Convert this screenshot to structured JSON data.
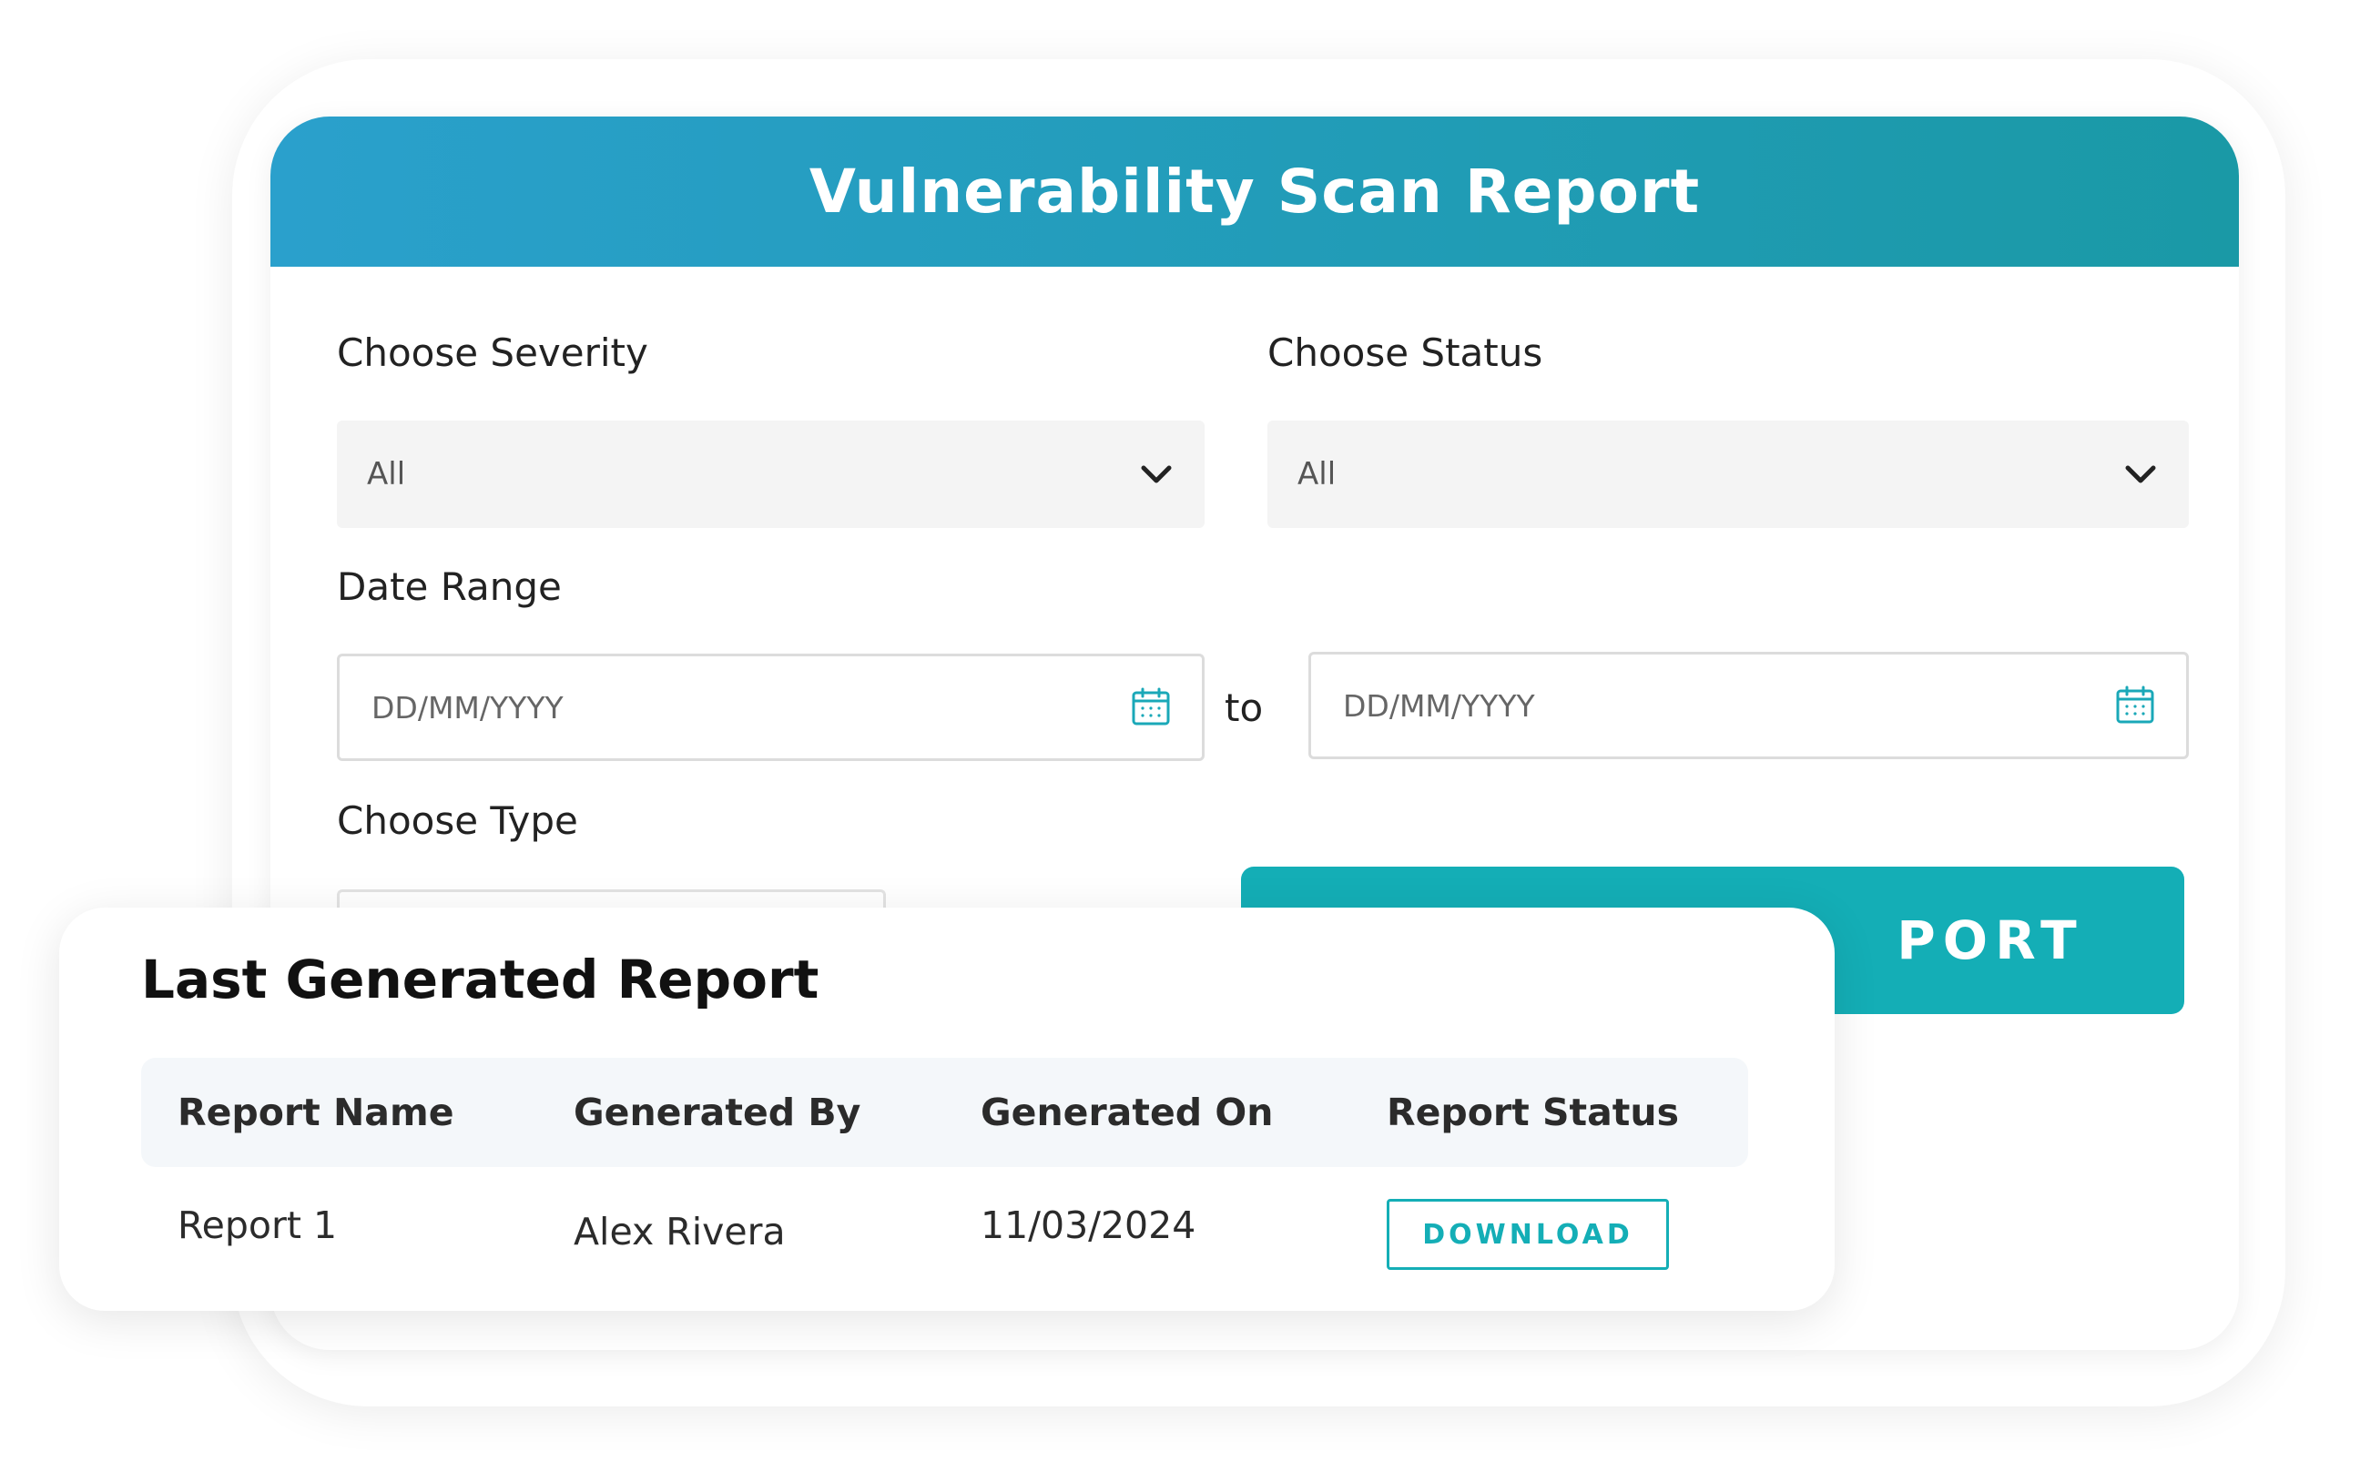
{
  "header": {
    "title": "Vulnerability Scan Report"
  },
  "form": {
    "severity": {
      "label": "Choose Severity",
      "value": "All"
    },
    "status": {
      "label": "Choose Status",
      "value": "All"
    },
    "date_range": {
      "label": "Date Range",
      "from_placeholder": "DD/MM/YYYY",
      "separator": "to",
      "to_placeholder": "DD/MM/YYYY"
    },
    "type": {
      "label": "Choose Type"
    },
    "generate_button_label": "PORT"
  },
  "last_report": {
    "title": "Last Generated Report",
    "columns": [
      "Report Name",
      "Generated By",
      "Generated On",
      "Report Status"
    ],
    "rows": [
      {
        "name": "Report 1",
        "generated_by": "Alex Rivera",
        "generated_on": "11/03/2024",
        "action_label": "DOWNLOAD"
      }
    ]
  },
  "colors": {
    "header_gradient_start": "#2aa0cc",
    "header_gradient_end": "#1a99a6",
    "accent": "#14aeb6",
    "icon": "#1aa8b8"
  },
  "icons": {
    "dropdown": "chevron-down-icon",
    "date": "calendar-icon"
  }
}
